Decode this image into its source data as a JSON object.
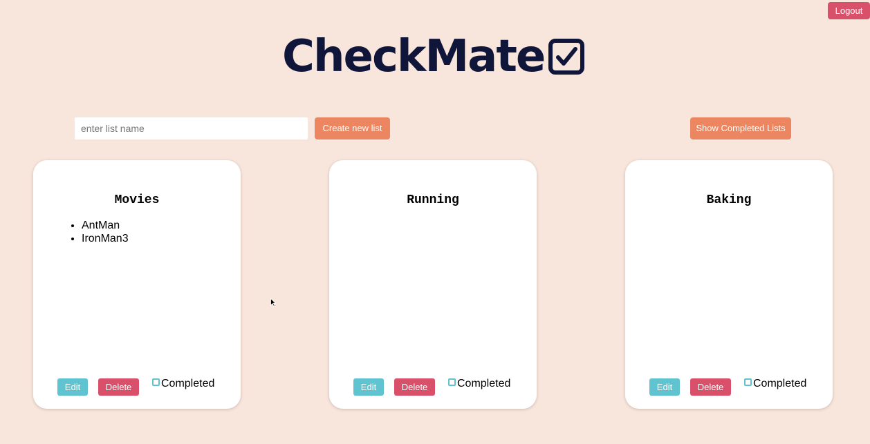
{
  "header": {
    "logout_label": "Logout",
    "brand_title": "CheckMate",
    "brand_icon": "checkbox-checked-icon"
  },
  "toolbar": {
    "list_name_placeholder": "enter list name",
    "list_name_value": "",
    "create_label": "Create new list",
    "show_completed_label": "Show Completed Lists"
  },
  "lists": [
    {
      "title": "Movies",
      "items": [
        "AntMan",
        "IronMan3"
      ],
      "edit_label": "Edit",
      "delete_label": "Delete",
      "completed_label": "Completed",
      "completed": false
    },
    {
      "title": "Running",
      "items": [],
      "edit_label": "Edit",
      "delete_label": "Delete",
      "completed_label": "Completed",
      "completed": false
    },
    {
      "title": "Baking",
      "items": [],
      "edit_label": "Edit",
      "delete_label": "Delete",
      "completed_label": "Completed",
      "completed": false
    }
  ],
  "colors": {
    "background": "#f8e5db",
    "brand": "#10163a",
    "accent_orange": "#ec8660",
    "danger": "#d9506a",
    "info": "#5fc4cf"
  }
}
